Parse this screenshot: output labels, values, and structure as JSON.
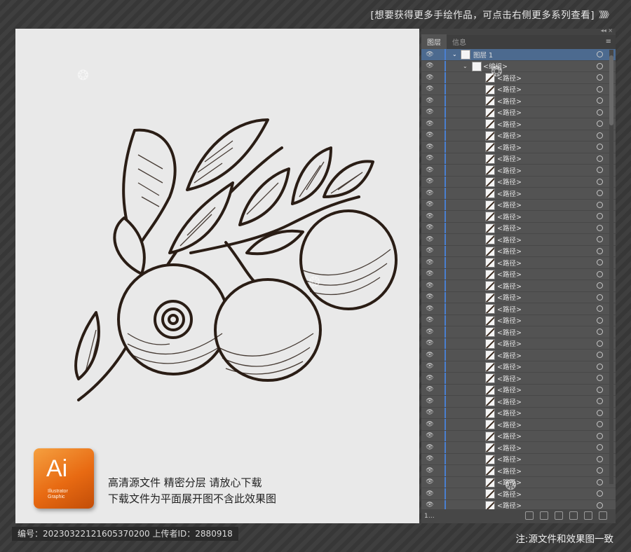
{
  "banner": {
    "text": "[想要获得更多手绘作品，可点击右侧更多系列查看]",
    "arrows": "》》》》"
  },
  "canvas": {
    "logo": {
      "big": "Ai",
      "sub1": "Illustrator",
      "sub2": "Graphic"
    },
    "caption_line1": "高清源文件   精密分层   请放心下载",
    "caption_line2": "下载文件为平面展开图不含此效果图"
  },
  "panel": {
    "tabs": [
      "图层",
      "信息"
    ],
    "collapse": "◂◂ ×",
    "menu": "≡",
    "layer": {
      "name": "图层 1"
    },
    "group": {
      "name": "<编组>"
    },
    "path_label": "<路径>",
    "path_rows": 40,
    "count": "1…"
  },
  "footer": {
    "id_text": "编号：20230322121605370200  上传者ID：2880918",
    "note": "注:源文件和效果图一致"
  },
  "colors": {
    "canvas_bg": "#e9e9e9",
    "panel_bg": "#535353",
    "selected_layer": "#4c6a8f",
    "layer_color_bar": "#4a7fd0",
    "ink": "#2a1d15"
  },
  "icons": [
    "eye-icon",
    "target-icon",
    "chevron-icon",
    "ai-logo-icon",
    "menu-icon"
  ]
}
